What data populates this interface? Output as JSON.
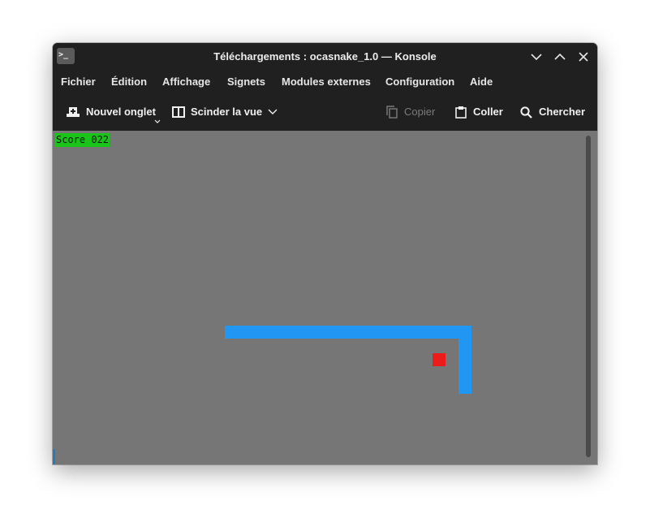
{
  "window": {
    "title": "Téléchargements : ocasnake_1.0 — Konsole",
    "app_icon_glyph": ">_"
  },
  "menu": [
    "Fichier",
    "Édition",
    "Affichage",
    "Signets",
    "Modules externes",
    "Configuration",
    "Aide"
  ],
  "toolbar": {
    "new_tab": "Nouvel onglet",
    "split_view": "Scinder la vue",
    "copy": "Copier",
    "paste": "Coller",
    "find": "Chercher"
  },
  "game": {
    "score_text": "Score 022",
    "colors": {
      "background": "#767676",
      "snake": "#2196f3",
      "food": "#ee1b1b",
      "score_bg": "#19c519"
    }
  }
}
